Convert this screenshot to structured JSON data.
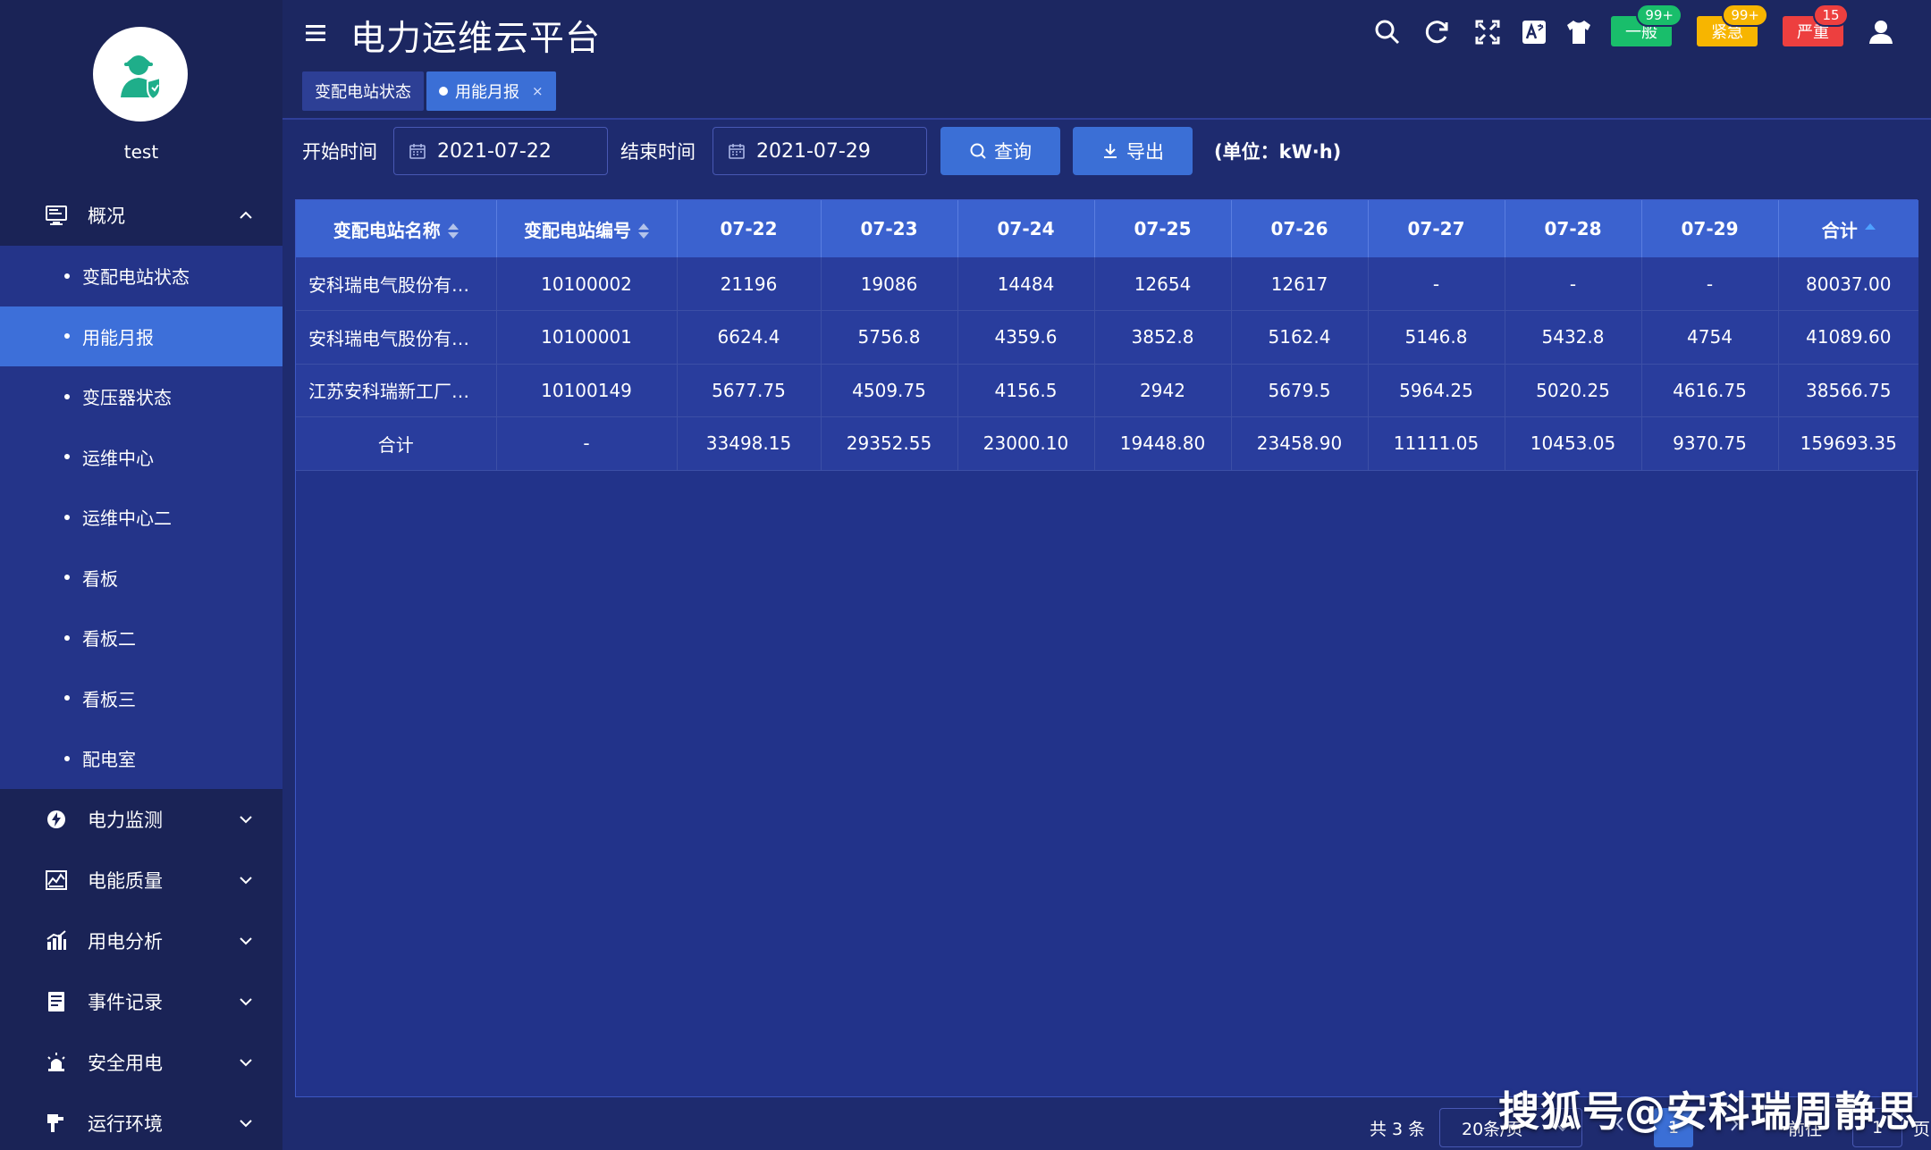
{
  "user": {
    "name": "test"
  },
  "header": {
    "title": "电力运维云平台"
  },
  "alarms": [
    {
      "label": "一般",
      "count": "99+",
      "color": "#19be6b"
    },
    {
      "label": "紧急",
      "count": "99+",
      "color": "#f7b500"
    },
    {
      "label": "严重",
      "count": "15",
      "color": "#ed3f3f"
    }
  ],
  "sidebar": {
    "groups": [
      {
        "label": "概况",
        "icon": "monitor-icon",
        "expanded": true,
        "items": [
          "变配电站状态",
          "用能月报",
          "变压器状态",
          "运维中心",
          "运维中心二",
          "看板",
          "看板二",
          "看板三",
          "配电室"
        ],
        "active_item": "用能月报"
      },
      {
        "label": "电力监测",
        "icon": "power-monitor-icon"
      },
      {
        "label": "电能质量",
        "icon": "power-quality-icon"
      },
      {
        "label": "用电分析",
        "icon": "bar-chart-icon"
      },
      {
        "label": "事件记录",
        "icon": "event-record-icon"
      },
      {
        "label": "安全用电",
        "icon": "alarm-light-icon"
      },
      {
        "label": "运行环境",
        "icon": "environment-icon"
      }
    ]
  },
  "tabs": [
    {
      "label": "变配电站状态",
      "active": false
    },
    {
      "label": "用能月报",
      "active": true,
      "close": "×"
    }
  ],
  "toolbar": {
    "start_label": "开始时间",
    "start_value": "2021-07-22",
    "end_label": "结束时间",
    "end_value": "2021-07-29",
    "query_label": "查询",
    "export_label": "导出",
    "unit": "(单位：kW·h)"
  },
  "table": {
    "columns": [
      "变配电站名称",
      "变配电站编号",
      "07-22",
      "07-23",
      "07-24",
      "07-25",
      "07-26",
      "07-27",
      "07-28",
      "07-29",
      "合计"
    ],
    "rows": [
      [
        "安科瑞电气股份有限公司",
        "10100002",
        "21196",
        "19086",
        "14484",
        "12654",
        "12617",
        "-",
        "-",
        "-",
        "80037.00"
      ],
      [
        "安科瑞电气股份有限公司",
        "10100001",
        "6624.4",
        "5756.8",
        "4359.6",
        "3852.8",
        "5162.4",
        "5146.8",
        "5432.8",
        "4754",
        "41089.60"
      ],
      [
        "江苏安科瑞新工厂配电",
        "10100149",
        "5677.75",
        "4509.75",
        "4156.5",
        "2942",
        "5679.5",
        "5964.25",
        "5020.25",
        "4616.75",
        "38566.75"
      ],
      [
        "合计",
        "-",
        "33498.15",
        "29352.55",
        "23000.10",
        "19448.80",
        "23458.90",
        "11111.05",
        "10453.05",
        "9370.75",
        "159693.35"
      ]
    ]
  },
  "pagination": {
    "total": "共 3 条",
    "page_size": "20条/页",
    "current": "1",
    "goto_label": "前往",
    "goto_value": "1",
    "page_suffix": "页"
  },
  "watermark": "搜狐号@安科瑞周静思"
}
